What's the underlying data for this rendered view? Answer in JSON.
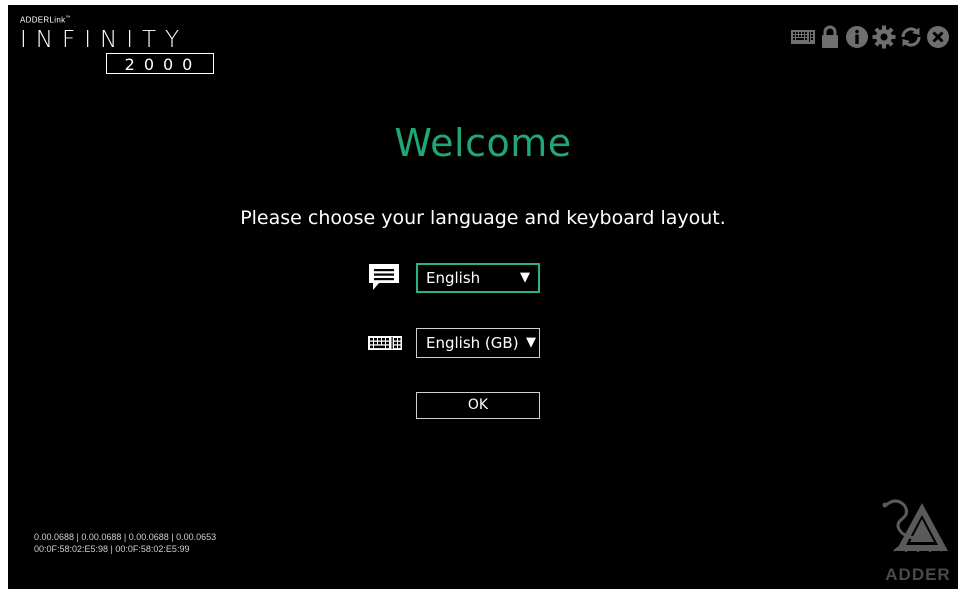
{
  "brand": {
    "small": "ADDERLink",
    "trademark": "™",
    "main": "INFINITY",
    "model": "2000"
  },
  "topbar": {
    "icons": [
      "keyboard-icon",
      "lock-icon",
      "info-icon",
      "gear-icon",
      "refresh-icon",
      "close-icon"
    ]
  },
  "main": {
    "title": "Welcome",
    "instructions": "Please choose your language and keyboard layout.",
    "language_select": {
      "value": "English",
      "icon": "speech-bubble-icon"
    },
    "keyboard_select": {
      "value": "English (GB)",
      "icon": "keyboard-icon"
    },
    "ok_label": "OK",
    "caret": "▼"
  },
  "footer": {
    "line1": "0.00.0688 | 0.00.0688 | 0.00.0688 | 0.00.0653",
    "line2": "00:0F:58:02:E5:98 | 00:0F:58:02:E5:99",
    "logo_text": "ADDER"
  },
  "colors": {
    "background": "#000000",
    "accent": "#1fa774",
    "focus_border": "#2bb37f",
    "icon_gray": "#6f6f6f"
  }
}
